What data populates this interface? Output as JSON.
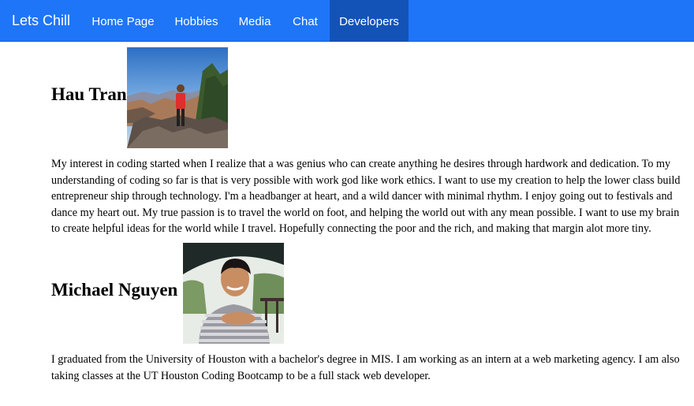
{
  "navbar": {
    "brand": "Lets Chill",
    "items": [
      {
        "label": "Home Page",
        "active": false
      },
      {
        "label": "Hobbies",
        "active": false
      },
      {
        "label": "Media",
        "active": false
      },
      {
        "label": "Chat",
        "active": false
      },
      {
        "label": "Developers",
        "active": true
      }
    ],
    "background_color": "#1f75f7",
    "active_color": "#1353b8"
  },
  "developers": [
    {
      "name": "Hau Tran",
      "photo": "hau-tran-photo",
      "bio": "My interest in coding started when I realize that a was genius who can create anything he desires through hardwork and dedication. To my understanding of coding so far is that is very possible with work god like work ethics. I want to use my creation to help the lower class build entrepreneur ship through technology. I'm a headbanger at heart, and a wild dancer with minimal rhythm. I enjoy going out to festivals and dance my heart out. My true passion is to travel the world on foot, and helping the world out with any mean possible. I want to use my brain to create helpful ideas for the world while I travel. Hopefully connecting the poor and the rich, and making that margin alot more tiny."
    },
    {
      "name": "Michael Nguyen",
      "photo": "michael-nguyen-photo",
      "bio": "I graduated from the University of Houston with a bachelor's degree in MIS. I am working as an intern at a web marketing agency. I am also taking classes at the UT Houston Coding Bootcamp to be a full stack web developer."
    }
  ]
}
